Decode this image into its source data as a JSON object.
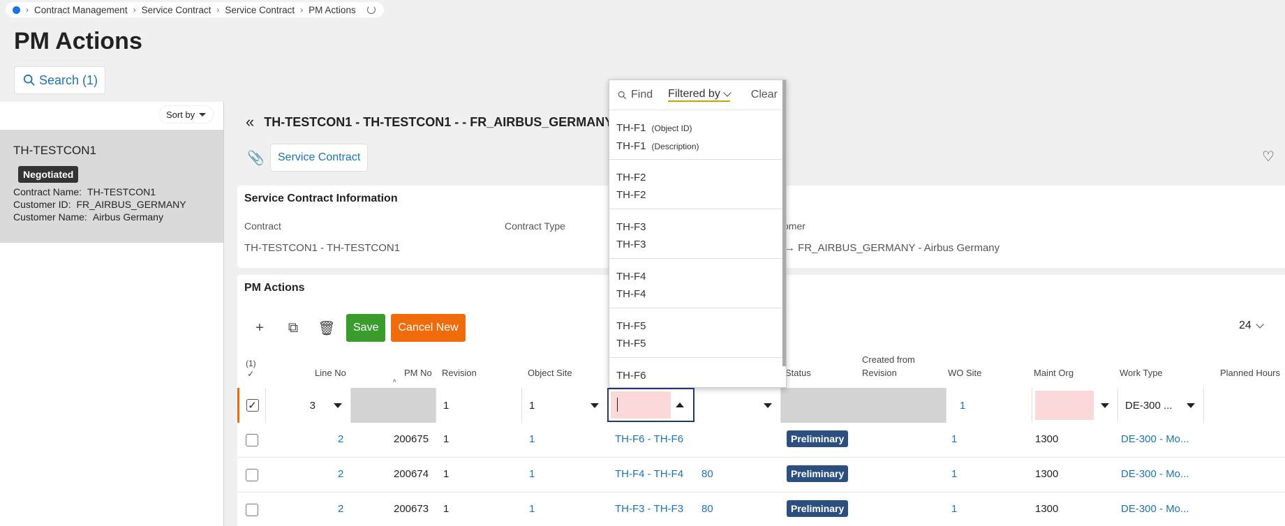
{
  "breadcrumb": [
    "Contract Management",
    "Service Contract",
    "Service Contract",
    "PM Actions"
  ],
  "page_title": "PM Actions",
  "search_button": "Search (1)",
  "sort_label": "Sort by",
  "card": {
    "title": "TH-TESTCON1",
    "status": "Negotiated",
    "lines": [
      {
        "label": "Contract Name:",
        "value": "TH-TESTCON1"
      },
      {
        "label": "Customer ID:",
        "value": "FR_AIRBUS_GERMANY"
      },
      {
        "label": "Customer Name:",
        "value": "Airbus Germany"
      }
    ]
  },
  "record_header": "TH-TESTCON1 - TH-TESTCON1 - - FR_AIRBUS_GERMANY",
  "service_contract_button": "Service Contract",
  "info": {
    "title": "Service Contract Information",
    "contract_label": "Contract",
    "contract_value": "TH-TESTCON1 - TH-TESTCON1",
    "contract_type_label": "Contract Type",
    "customer_label": "omer",
    "customer_value": "FR_AIRBUS_GERMANY - Airbus Germany"
  },
  "grid": {
    "title": "PM Actions",
    "save": "Save",
    "cancel_new": "Cancel New",
    "page_size": "24",
    "selected_count": "(1)",
    "headers": {
      "line_no": "Line No",
      "pm_no": "PM No",
      "revision": "Revision",
      "object_site": "Object Site",
      "status": "Status",
      "created_from": "Created from",
      "revision2": "Revision",
      "wo_site": "WO Site",
      "maint_org": "Maint Org",
      "work_type": "Work Type",
      "planned_hours": "Planned Hours"
    },
    "edit_row": {
      "line_no": "3",
      "revision": "1",
      "object_site": "1",
      "wo_site": "1",
      "work_type": "DE-300 ..."
    },
    "rows": [
      {
        "line_no": "2",
        "pm_no": "200675",
        "revision": "1",
        "object_site": "1",
        "object": "TH-F6 - TH-F6",
        "extra": "",
        "status": "Preliminary",
        "wo_site": "1",
        "maint_org": "1300",
        "work_type": "DE-300 - Mo..."
      },
      {
        "line_no": "2",
        "pm_no": "200674",
        "revision": "1",
        "object_site": "1",
        "object": "TH-F4 - TH-F4",
        "extra": "80",
        "status": "Preliminary",
        "wo_site": "1",
        "maint_org": "1300",
        "work_type": "DE-300 - Mo..."
      },
      {
        "line_no": "2",
        "pm_no": "200673",
        "revision": "1",
        "object_site": "1",
        "object": "TH-F3 - TH-F3",
        "extra": "80",
        "status": "Preliminary",
        "wo_site": "1",
        "maint_org": "1300",
        "work_type": "DE-300 - Mo..."
      }
    ]
  },
  "popup": {
    "find": "Find",
    "filtered_by": "Filtered by",
    "clear": "Clear",
    "items": [
      {
        "id": "TH-F1",
        "desc": "TH-F1",
        "id_hint": "(Object ID)",
        "desc_hint": "(Description)"
      },
      {
        "id": "TH-F2",
        "desc": "TH-F2"
      },
      {
        "id": "TH-F3",
        "desc": "TH-F3"
      },
      {
        "id": "TH-F4",
        "desc": "TH-F4"
      },
      {
        "id": "TH-F5",
        "desc": "TH-F5"
      },
      {
        "id": "TH-F6",
        "desc": ""
      }
    ]
  }
}
